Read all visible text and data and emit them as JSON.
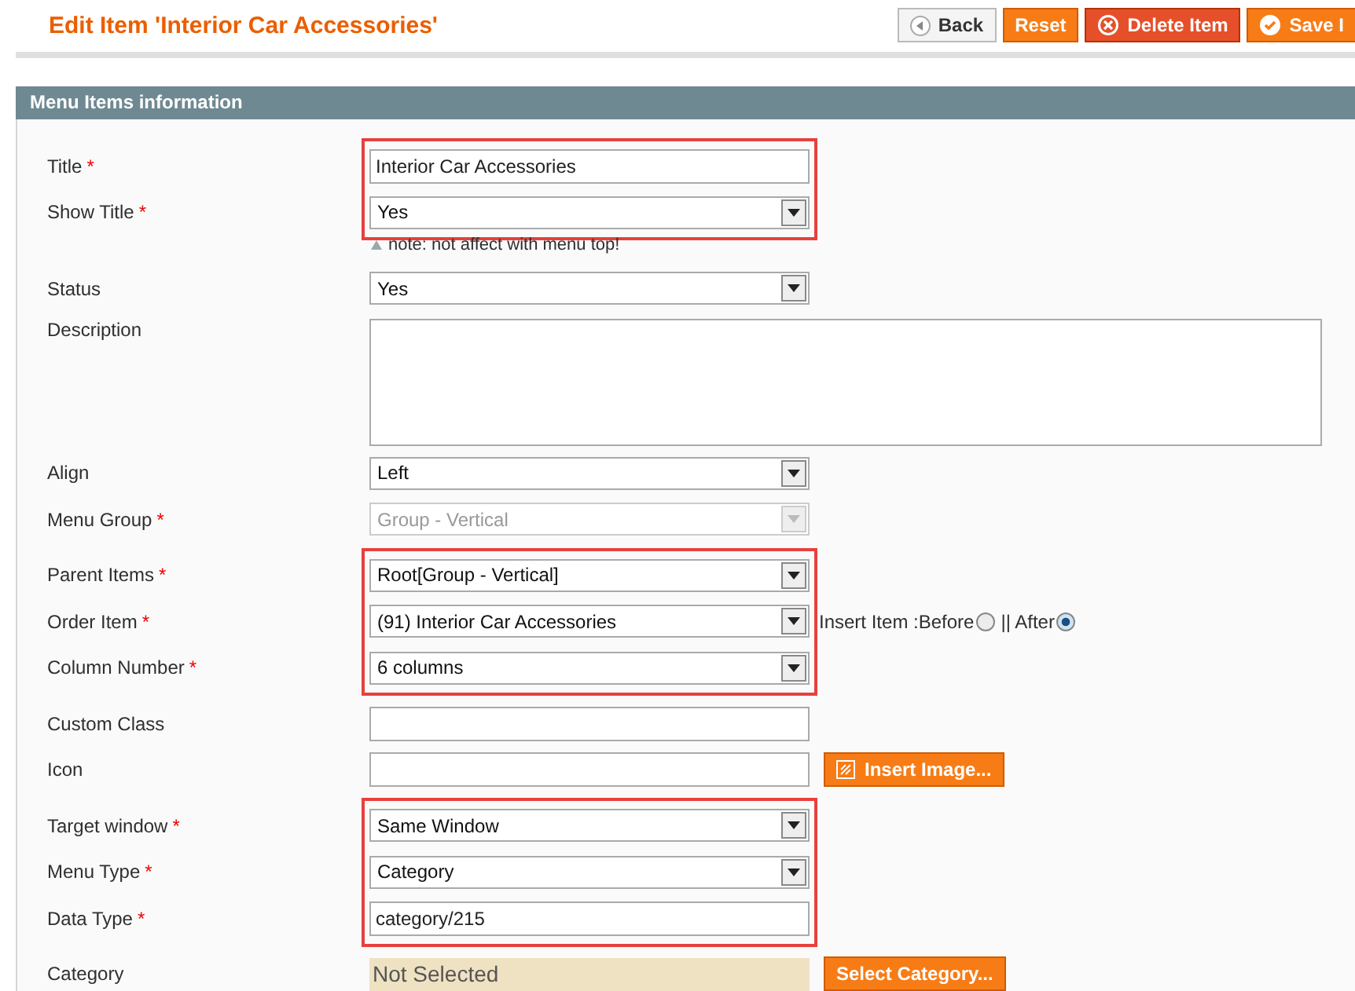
{
  "header": {
    "title": "Edit Item 'Interior Car Accessories'"
  },
  "actions": [
    {
      "kind": "back",
      "label": "Back"
    },
    {
      "kind": "reset",
      "label": "Reset"
    },
    {
      "kind": "delete",
      "label": "Delete Item"
    },
    {
      "kind": "save",
      "label": "Save I"
    }
  ],
  "panel": {
    "title": "Menu Items information"
  },
  "groups": [
    {
      "highlighted": true,
      "note": "note: not affect with menu top!",
      "fields": [
        {
          "kind": "text",
          "label": "Title",
          "required_mark": "*",
          "value": "Interior Car Accessories"
        },
        {
          "kind": "select",
          "label": "Show Title",
          "required_mark": "*",
          "value": "Yes"
        }
      ]
    },
    {
      "highlighted": false,
      "fields": [
        {
          "kind": "select",
          "label": "Status",
          "value": "Yes"
        },
        {
          "kind": "textarea",
          "label": "Description"
        },
        {
          "kind": "select",
          "label": "Align",
          "value": "Left"
        },
        {
          "kind": "select",
          "label": "Menu Group",
          "required_mark": "*",
          "value": "Group - Vertical",
          "disabled": true
        }
      ]
    },
    {
      "highlighted": true,
      "fields": [
        {
          "kind": "select",
          "label": "Parent Items",
          "required_mark": "*",
          "value": "Root[Group - Vertical]"
        },
        {
          "kind": "select",
          "label": "Order Item",
          "required_mark": "*",
          "value": "(91) Interior Car Accessories",
          "insert": {
            "label": "Insert Item : ",
            "options": [
              {
                "label": "Before",
                "selected": false
              },
              {
                "label": "|| After",
                "selected": true
              }
            ]
          }
        },
        {
          "kind": "select",
          "label": "Column Number",
          "required_mark": "*",
          "value": "6 columns"
        }
      ]
    },
    {
      "highlighted": false,
      "fields": [
        {
          "kind": "text",
          "label": "Custom Class"
        },
        {
          "kind": "text",
          "label": "Icon",
          "button": "Insert Image..."
        }
      ]
    },
    {
      "highlighted": true,
      "fields": [
        {
          "kind": "select",
          "label": "Target window",
          "required_mark": "*",
          "value": "Same Window"
        },
        {
          "kind": "select",
          "label": "Menu Type",
          "required_mark": "*",
          "value": "Category"
        },
        {
          "kind": "text",
          "label": "Data Type",
          "required_mark": "*",
          "value": "category/215"
        }
      ]
    },
    {
      "highlighted": false,
      "fields": [
        {
          "kind": "display",
          "label": "Category",
          "value": "Not Selected",
          "button": "Select Category..."
        }
      ]
    }
  ]
}
